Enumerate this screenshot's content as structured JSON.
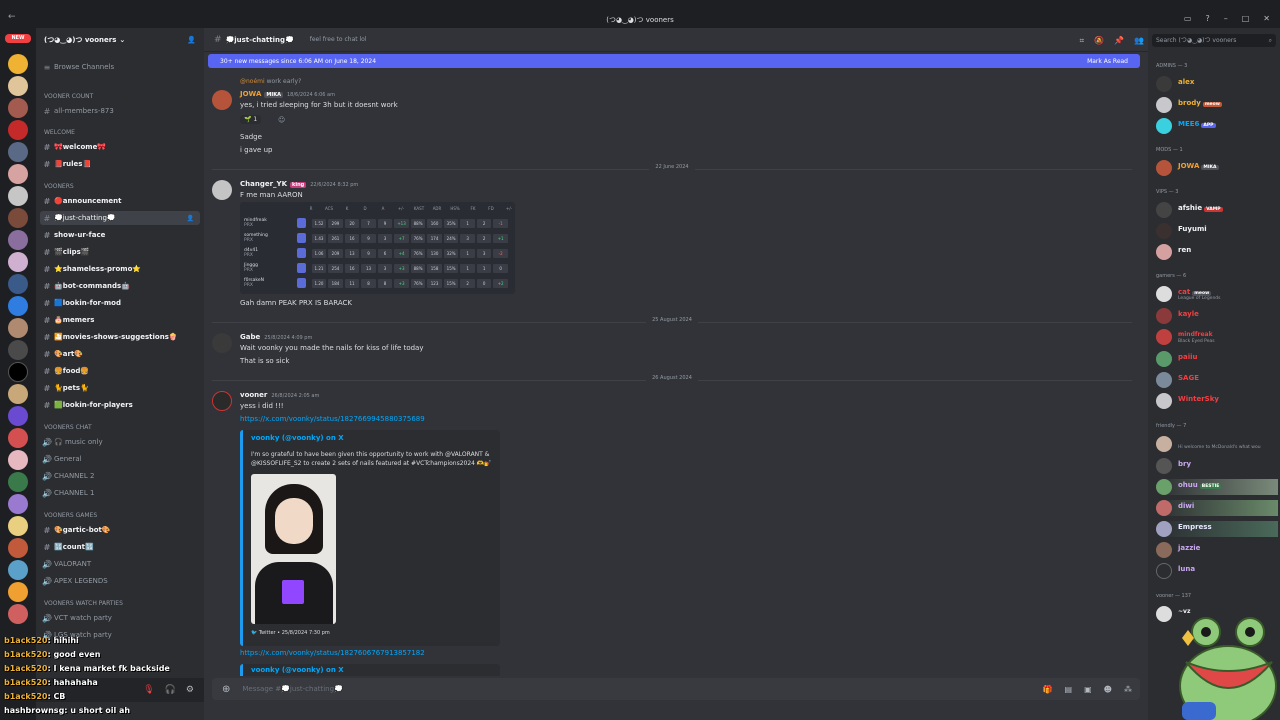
{
  "window": {
    "title": "(つ◕‿◕)つ vooners",
    "back": "←"
  },
  "rail": {
    "new_badge": "NEW"
  },
  "server": {
    "name": "(つ◕‿◕)つ vooners",
    "browse": "Browse Channels"
  },
  "categories": {
    "count": "VOONER COUNT",
    "welcome": "WELCOME",
    "vooners": "VOONERS",
    "chat": "VOONERS CHAT",
    "games": "VOONERS GAMES",
    "watch": "VOONERS WATCH PARTIES"
  },
  "channels": {
    "all_members": "all-members-873",
    "welcome": "🎀welcome🎀",
    "rules": "📕rules📕",
    "announcement": "🔴announcement",
    "just_chatting": "💭just-chatting💭",
    "show_ur_face": "show-ur-face",
    "clips": "🎬clips🎬",
    "shameless": "⭐shameless-promo⭐",
    "bot_commands": "🤖bot-commands🤖",
    "lookin_mod": "🟦lookin-for-mod",
    "memers": "🎂memers",
    "movies": "🎦movies-shows-suggestions🍿",
    "art": "🎨art🎨",
    "food": "🍔food🍔",
    "pets": "🐈pets🐈",
    "lookin_players": "🟩lookin-for-players",
    "music_only": "🎧 music only",
    "general": "General",
    "ch2": "CHANNEL 2",
    "ch1": "CHANNEL 1",
    "gartic": "🎨gartic-bot🎨",
    "count": "🔢count🔢",
    "valorant": "VALORANT",
    "apex": "APEX LEGENDS",
    "vct_watch": "VCT watch party",
    "lgs_watch": "LGS watch party"
  },
  "overlay_chat": [
    {
      "name": "b1ack520",
      "text": "hihihi"
    },
    {
      "name": "b1ack520",
      "text": "good even"
    },
    {
      "name": "b1ack520",
      "text": "I kena market fk backside"
    },
    {
      "name": "b1ack520",
      "text": "hahahaha"
    },
    {
      "name": "b1ack520",
      "text": "CB"
    },
    {
      "name": "hashbrownsg",
      "text": "u short oil ah"
    }
  ],
  "header": {
    "channel": "💭just-chatting💭",
    "topic": "feel free to chat lol"
  },
  "new_messages": {
    "text": "30+ new messages since 6:06 AM on June 18, 2024",
    "mark": "Mark As Read"
  },
  "messages": {
    "reply_name": "@noémi",
    "reply_text": "work early?",
    "m1": {
      "user": "JOWA",
      "tag": "MIKA",
      "time": "18/6/2024 6:06 am",
      "l1": "yes, i tried sleeping for 3h but it doesnt work",
      "react": "1",
      "l2": "Sadge",
      "l3": "i gave up"
    },
    "d1": "22 June 2024",
    "m2": {
      "user": "Changer_YK",
      "tag": "king",
      "time": "22/6/2024 8:32 pm",
      "l1": "F me man AARON",
      "l2": "Gah damn PEAK PRX IS BARACK"
    },
    "d2": "25 August 2024",
    "m3": {
      "user": "Gabe",
      "time": "25/8/2024 4:09 pm",
      "l1": "Wait voonky you made the nails for kiss of life today",
      "l2": "That is so sick"
    },
    "d3": "26 August 2024",
    "m4": {
      "user": "vooner",
      "time": "26/8/2024 2:05 am",
      "l1": "yess i did !!!",
      "link1": "https://x.com/voonky/status/1827669945880375689",
      "link2": "https://x.com/voonky/status/1827606767913857182"
    }
  },
  "stats": {
    "headers": [
      "R",
      "ACS",
      "K",
      "D",
      "A",
      "+/-",
      "KAST",
      "ADR",
      "HS%",
      "FK",
      "FD",
      "+/-"
    ],
    "rows": [
      {
        "player": "mindfreak",
        "team": "PRX",
        "cells": [
          "1.52",
          "299",
          "20",
          "7",
          "9",
          "+13",
          "88%",
          "160",
          "35%",
          "1",
          "2",
          "-1"
        ]
      },
      {
        "player": "something",
        "team": "PRX",
        "cells": [
          "1.43",
          "261",
          "16",
          "9",
          "3",
          "+7",
          "76%",
          "174",
          "24%",
          "3",
          "2",
          "+1"
        ]
      },
      {
        "player": "d4v41",
        "team": "PRX",
        "cells": [
          "1.06",
          "209",
          "13",
          "9",
          "6",
          "+4",
          "76%",
          "130",
          "32%",
          "1",
          "3",
          "-2"
        ]
      },
      {
        "player": "Jinggg",
        "team": "PRX",
        "cells": [
          "1.21",
          "254",
          "16",
          "13",
          "3",
          "+3",
          "88%",
          "158",
          "15%",
          "1",
          "1",
          "0"
        ]
      },
      {
        "player": "f0rsakeN",
        "team": "PRX",
        "cells": [
          "1.20",
          "184",
          "11",
          "8",
          "8",
          "+3",
          "76%",
          "123",
          "15%",
          "2",
          "0",
          "+2"
        ]
      }
    ]
  },
  "embed": {
    "author": "voonky (@voonky) on X",
    "desc": "I'm so grateful to have been given this opportunity to work with @VALORANT & @KISSOFLIFE_S2 to create 2 sets of nails featured at #VCTchampions2024 🫶💅",
    "footer": "Twitter • 25/8/2024 7:30 pm",
    "author2": "voonky (@voonky) on X"
  },
  "composer": {
    "placeholder": "Message #💭just-chatting💭"
  },
  "member_search": {
    "placeholder": "Search (つ◕‿◕)つ vooners"
  },
  "member_groups": {
    "admins": "ADMINS — 3",
    "mods": "MODS — 1",
    "vips": "VIPS — 3",
    "gamers": "gamers — 6",
    "friendly": "friendly — 7",
    "vooner": "vooner — 137"
  },
  "members": {
    "alex": "alex",
    "brody": "brody",
    "brody_tag": "meow",
    "mee6": "MEE6",
    "mee6_tag": "APP",
    "jowa": "JOWA",
    "jowa_tag": "MIKA",
    "afshie": "afshie",
    "afshie_tag": "VAMP",
    "fuyumi": "Fuyumi",
    "ren": "ren",
    "cat": "cat",
    "cat_tag": "meow",
    "cat_status": "League of Legends",
    "kayle": "kayle",
    "mindfreak": "mindfreak",
    "mindfreak_status": "Black Eyed Peas",
    "paiiu": "paiiu",
    "sage": "SAGE",
    "wintersky": "WinterSky",
    "friendly_status": "Hi welcome to McDonald's what wou",
    "bry": "bry",
    "ohuu": "ohuu",
    "ohuu_tag": "BESTIE",
    "diwi": "diwi",
    "empress": "Empress",
    "jazzie": "jazzie",
    "luna": "luna",
    "vz": "~vz"
  }
}
